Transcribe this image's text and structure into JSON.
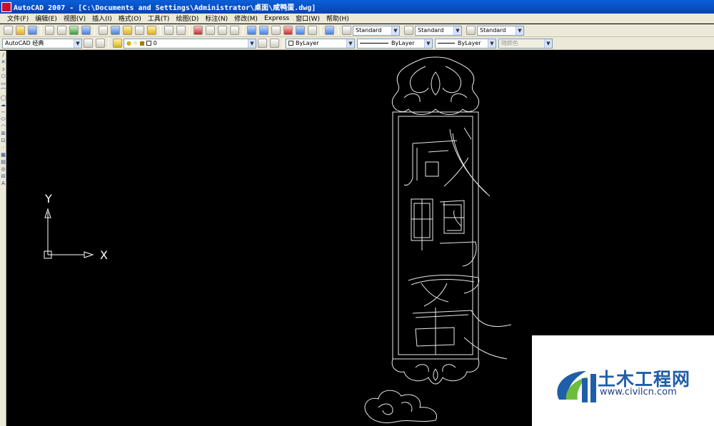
{
  "window": {
    "title": "AutoCAD 2007 - [C:\\Documents and Settings\\Administrator\\桌面\\咸鸭蛋.dwg]"
  },
  "menu": [
    "文件(F)",
    "编辑(E)",
    "视图(V)",
    "插入(I)",
    "格式(O)",
    "工具(T)",
    "绘图(D)",
    "标注(N)",
    "修改(M)",
    "Express",
    "窗口(W)",
    "帮助(H)"
  ],
  "styles": {
    "text_style": "Standard",
    "dim_style": "Standard",
    "table_style": "Standard"
  },
  "workspace": {
    "name": "AutoCAD 经典"
  },
  "layer": {
    "current": "0"
  },
  "properties": {
    "color": "ByLayer",
    "linetype": "ByLayer",
    "lineweight": "ByLayer",
    "plot_style": "随颜色"
  },
  "ucs": {
    "x_label": "X",
    "y_label": "Y"
  },
  "drawing": {
    "title_chars": [
      "咸",
      "鸭",
      "蛋"
    ]
  },
  "watermark": {
    "brand": "土木工程网",
    "url": "www.civilcn.com",
    "colors": {
      "primary": "#1f5ea8",
      "accent": "#6cbd3c"
    }
  },
  "icons": {
    "left_toolbar": [
      "line-icon",
      "xline-icon",
      "polyline-icon",
      "polygon-icon",
      "rectangle-icon",
      "arc-icon",
      "circle-icon",
      "revcloud-icon",
      "spline-icon",
      "ellipse-icon",
      "ellipse-arc-icon",
      "insert-block-icon",
      "make-block-icon",
      "point-icon",
      "hatch-icon",
      "gradient-icon",
      "region-icon",
      "table-icon",
      "mtext-icon"
    ]
  }
}
